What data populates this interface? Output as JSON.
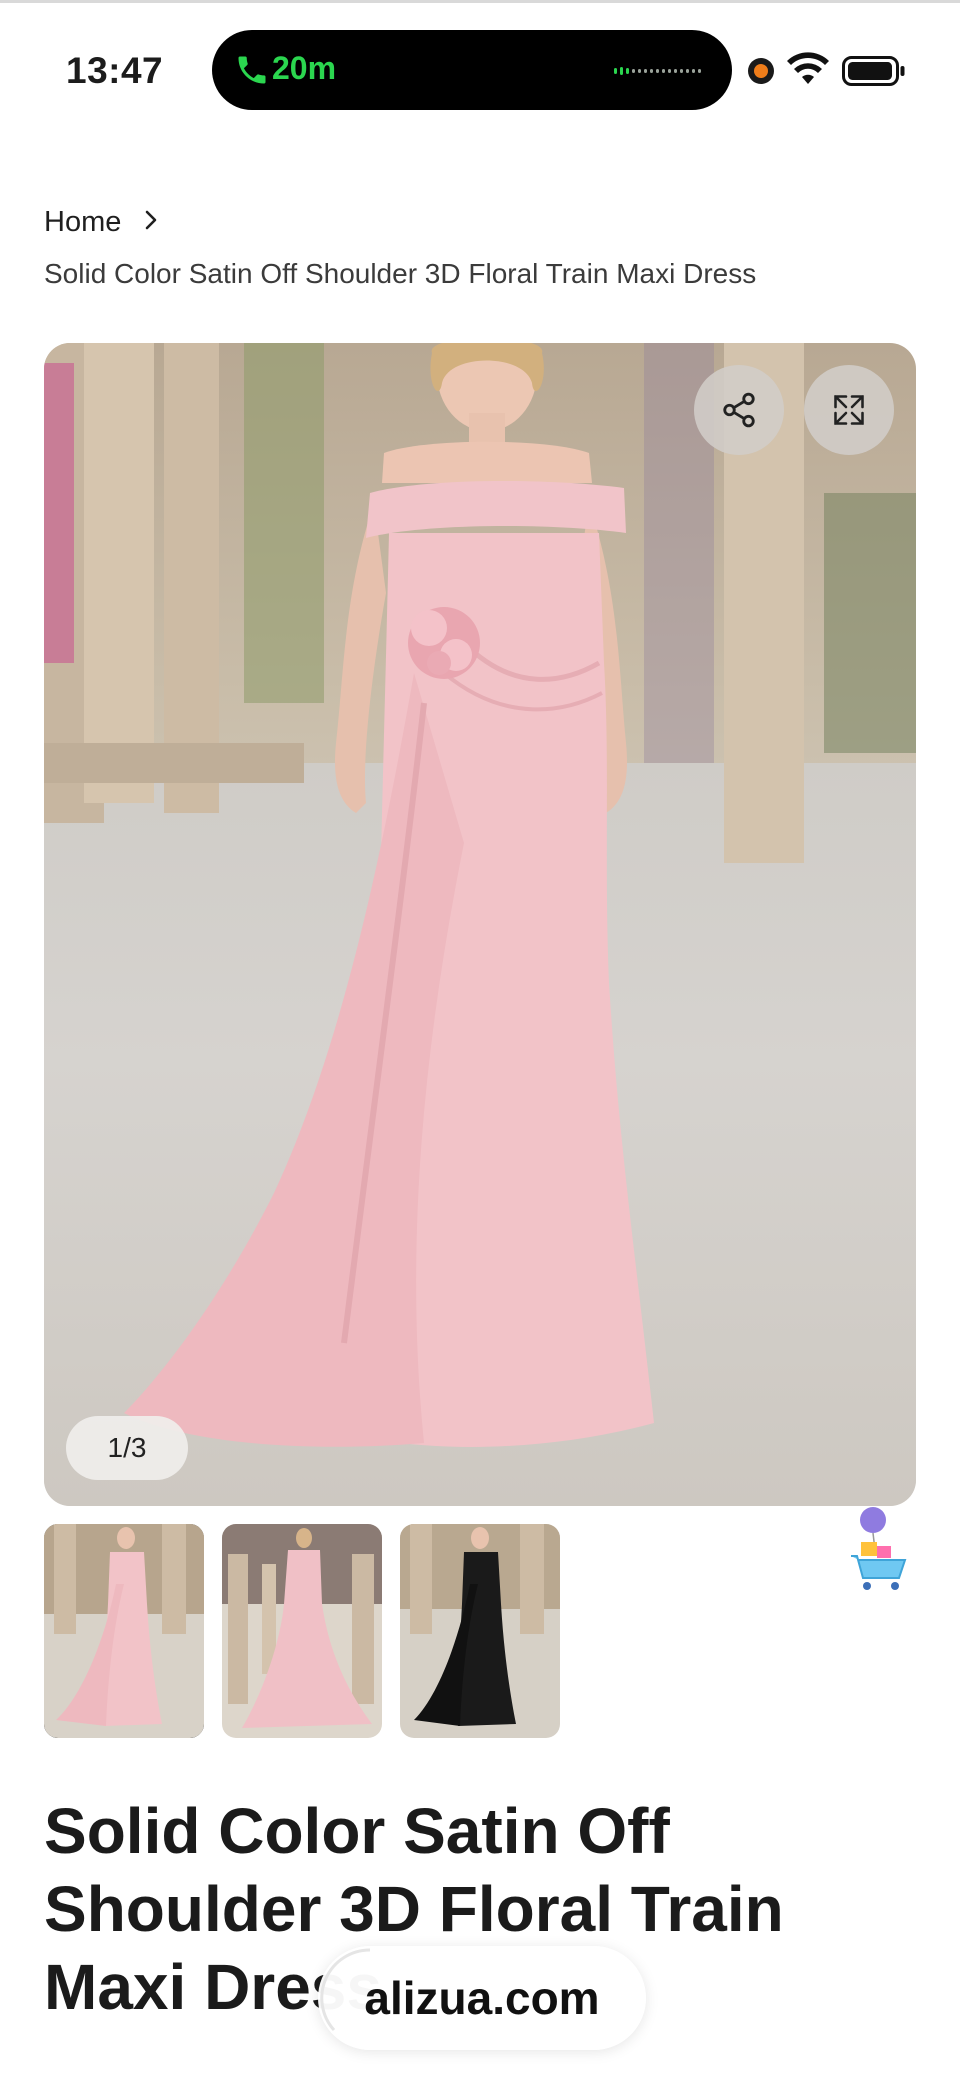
{
  "status_bar": {
    "time": "13:47",
    "call_duration": "20m",
    "icons": [
      "phone-icon",
      "waveform-icon",
      "recording-dot-icon",
      "wifi-icon",
      "battery-icon"
    ]
  },
  "breadcrumb": {
    "home": "Home",
    "separator_icon": "chevron-right-icon",
    "current": "Solid Color Satin Off Shoulder 3D Floral Train Maxi Dress"
  },
  "gallery": {
    "counter": "1/3",
    "current_index": 1,
    "total": 3,
    "share_icon": "share-icon",
    "expand_icon": "expand-icon",
    "thumbnails": [
      {
        "label": "pink-dress-front",
        "color": "#f2c3c8",
        "active": true
      },
      {
        "label": "pink-dress-back",
        "color": "#f0c0c6",
        "active": false
      },
      {
        "label": "black-dress-front",
        "color": "#1a1a1a",
        "active": false
      }
    ]
  },
  "product": {
    "title": "Solid Color Satin Off Shoulder 3D Floral Train Maxi Dress",
    "title_visible_line3": "Maxi Dre"
  },
  "overlay": {
    "url": "alizua.com"
  },
  "colors": {
    "accent_green": "#2bd64f",
    "dress_pink": "#f2c3c8",
    "text_dark": "#1b1b1b"
  }
}
